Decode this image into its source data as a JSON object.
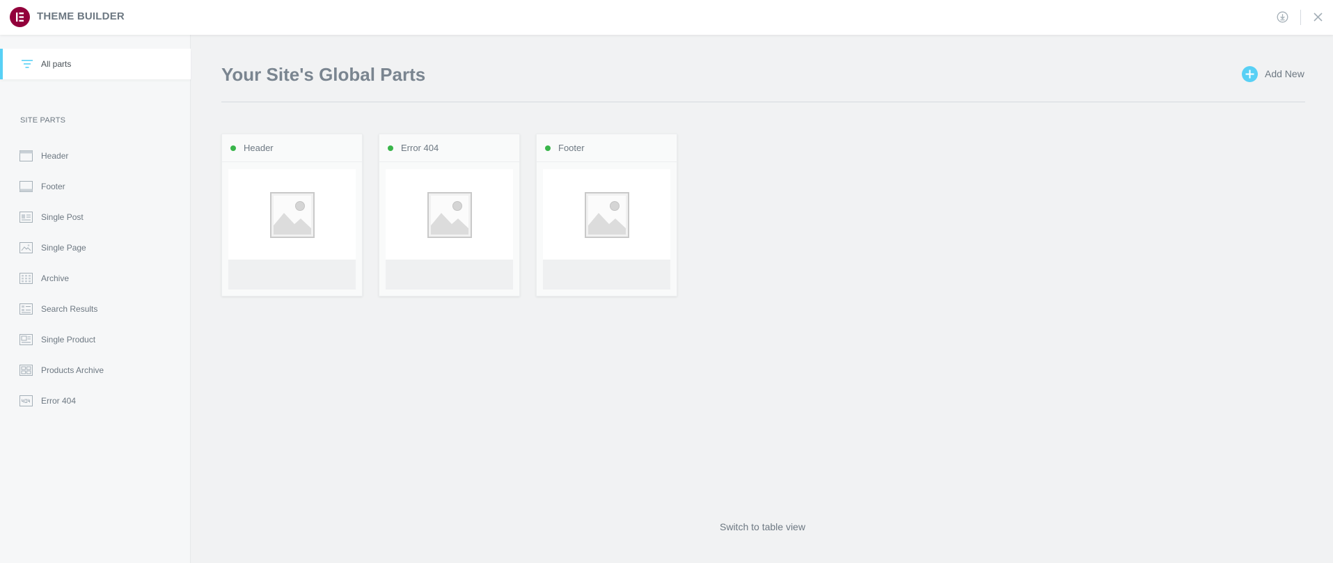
{
  "app": {
    "title": "THEME BUILDER"
  },
  "colors": {
    "brand": "#92003b",
    "accent": "#58d0f5",
    "status_active": "#39b54a"
  },
  "header_icons": [
    "info-download-icon",
    "close-icon"
  ],
  "sidebar": {
    "all_parts_label": "All parts",
    "section_title": "SITE PARTS",
    "items": [
      {
        "label": "Header",
        "icon": "header-layout-icon"
      },
      {
        "label": "Footer",
        "icon": "footer-layout-icon"
      },
      {
        "label": "Single Post",
        "icon": "single-post-icon"
      },
      {
        "label": "Single Page",
        "icon": "single-page-icon"
      },
      {
        "label": "Archive",
        "icon": "archive-grid-icon"
      },
      {
        "label": "Search Results",
        "icon": "search-results-icon"
      },
      {
        "label": "Single Product",
        "icon": "single-product-icon"
      },
      {
        "label": "Products Archive",
        "icon": "products-archive-icon"
      },
      {
        "label": "Error 404",
        "icon": "error-404-icon"
      }
    ]
  },
  "main": {
    "title": "Your Site's Global Parts",
    "add_new_label": "Add New",
    "cards": [
      {
        "title": "Header",
        "status": "active"
      },
      {
        "title": "Error 404",
        "status": "active"
      },
      {
        "title": "Footer",
        "status": "active"
      }
    ],
    "switch_view_label": "Switch to table view"
  }
}
